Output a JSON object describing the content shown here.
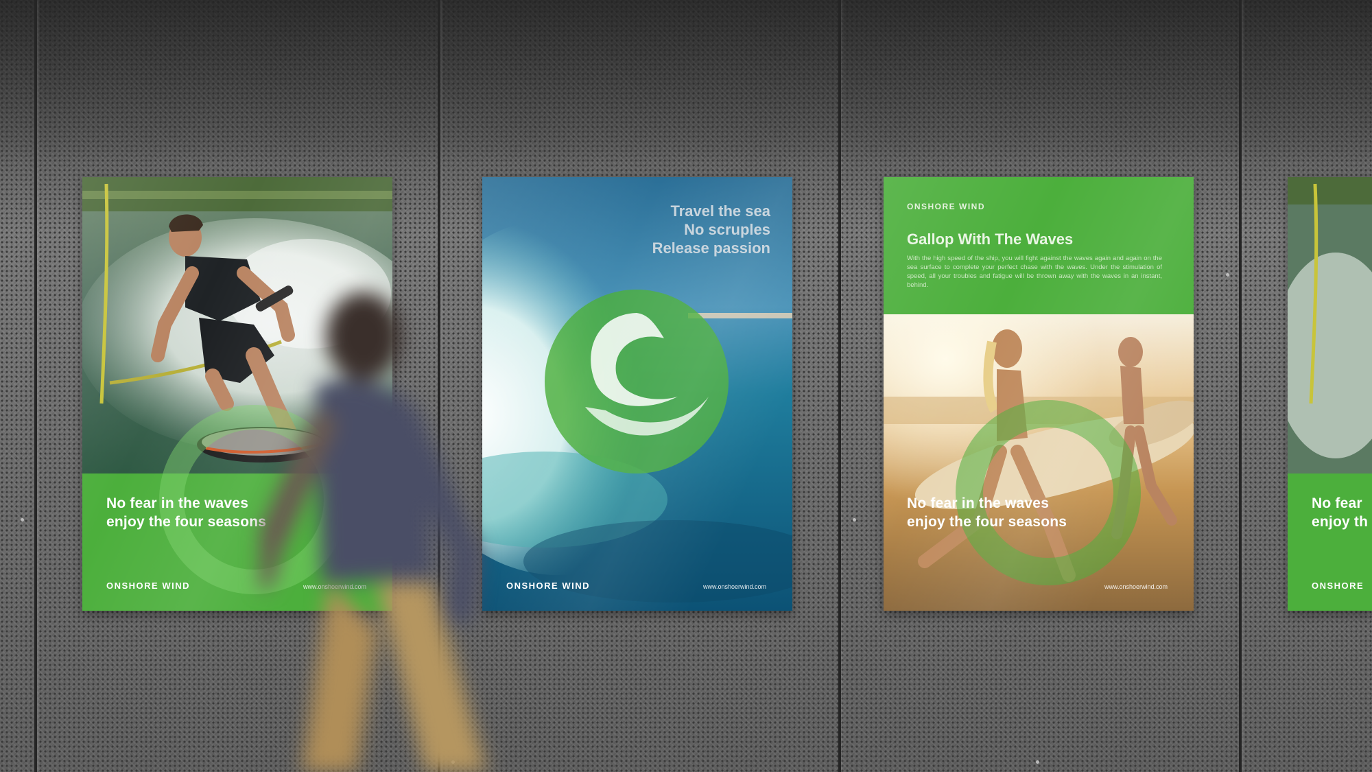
{
  "posters": {
    "left": {
      "tagline_line1": "No fear in the waves",
      "tagline_line2": "enjoy the four seasons",
      "brand": "ONSHORE WIND",
      "url": "www.onshoerwind.com"
    },
    "center": {
      "headline_line1": "Travel the sea",
      "headline_line2": "No scruples",
      "headline_line3": "Release passion",
      "brand": "ONSHORE WIND",
      "url": "www.onshoerwind.com"
    },
    "right": {
      "brand": "ONSHORE WIND",
      "title": "Gallop With The Waves",
      "body": "With the high speed of the ship, you will fight against the waves again and again on the sea surface to complete your perfect chase with the waves. Under the stimulation of speed, all your troubles and fatigue will be thrown away with the waves in an instant, behind.",
      "tagline_line1": "No fear in the waves",
      "tagline_line2": "enjoy the four seasons",
      "url": "www.onshoerwind.com"
    },
    "partial": {
      "tagline_line1": "No fear",
      "tagline_line2": "enjoy th",
      "brand": "ONSHORE"
    }
  },
  "colors": {
    "brand_green": "#4caf3c",
    "wall": "#6a6a6a"
  }
}
